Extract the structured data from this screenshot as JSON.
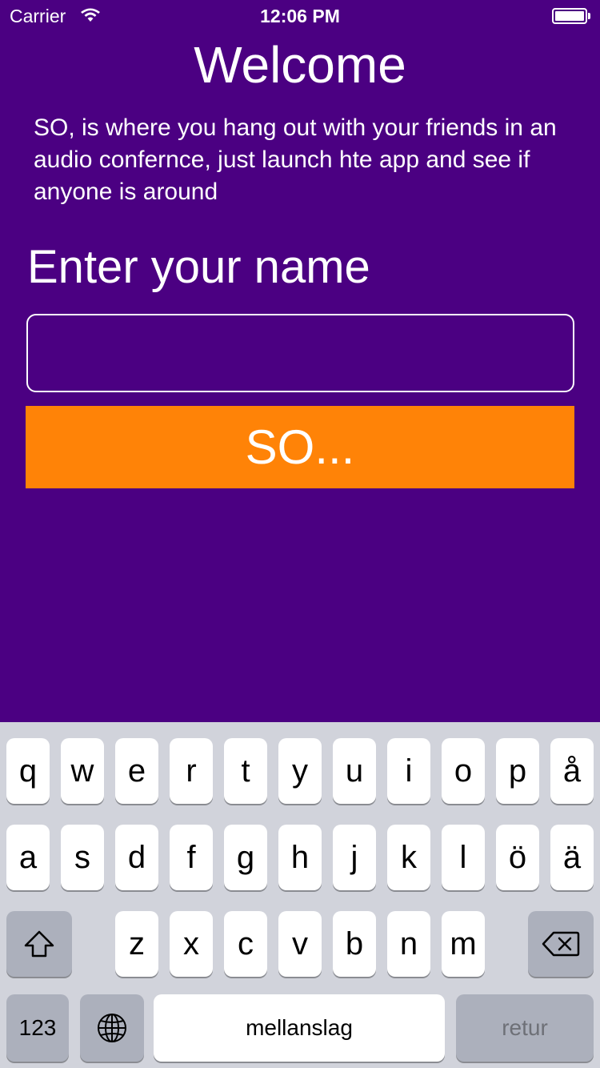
{
  "status_bar": {
    "carrier": "Carrier",
    "time": "12:06 PM"
  },
  "main": {
    "title": "Welcome",
    "description": "SO, is where you hang out with your friends in an audio confernce, just launch hte app and see if anyone is around",
    "name_label": "Enter your name",
    "name_input_value": "",
    "submit_label": "SO..."
  },
  "keyboard": {
    "row1": [
      "q",
      "w",
      "e",
      "r",
      "t",
      "y",
      "u",
      "i",
      "o",
      "p",
      "å"
    ],
    "row2": [
      "a",
      "s",
      "d",
      "f",
      "g",
      "h",
      "j",
      "k",
      "l",
      "ö",
      "ä"
    ],
    "row3": [
      "z",
      "x",
      "c",
      "v",
      "b",
      "n",
      "m"
    ],
    "numbers_label": "123",
    "space_label": "mellanslag",
    "return_label": "retur",
    "shift_icon": "shift-icon",
    "backspace_icon": "backspace-icon",
    "globe_icon": "globe-icon"
  },
  "colors": {
    "background": "#4B0082",
    "button": "#FF8307",
    "keyboard_bg": "#D1D3DB",
    "special_key": "#ACB0BC"
  }
}
